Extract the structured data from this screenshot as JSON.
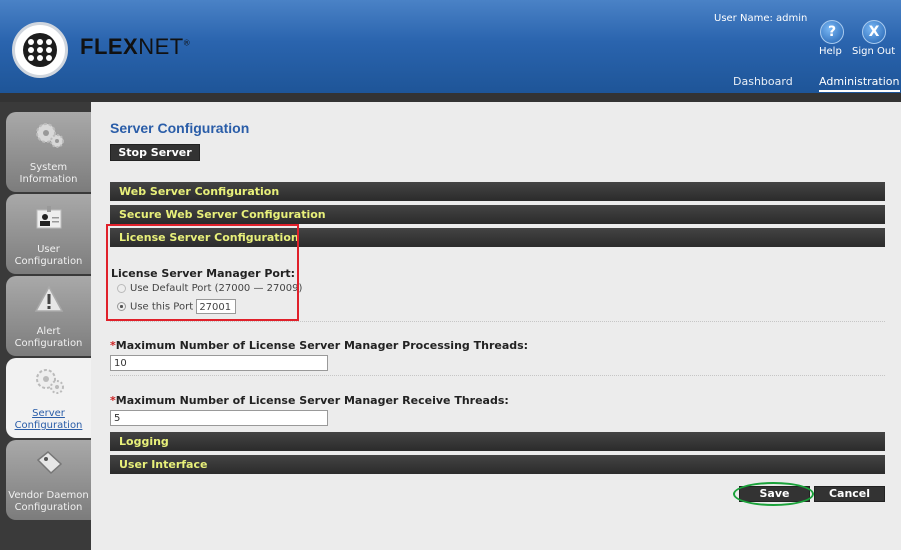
{
  "app": {
    "brand_bold": "FLEX",
    "brand_light": "NET",
    "brand_mark": "®"
  },
  "header": {
    "user_name": "User Name: admin",
    "help_label": "Help",
    "signout_label": "Sign Out",
    "help_icon": "question-icon",
    "signout_icon": "x-icon",
    "nav": [
      {
        "label": "Dashboard",
        "active": false
      },
      {
        "label": "Administration",
        "active": true
      }
    ]
  },
  "sidebar": {
    "items": [
      {
        "label": "System Information",
        "icon": "gears-icon",
        "active": false
      },
      {
        "label": "User Configuration",
        "icon": "user-card-icon",
        "active": false
      },
      {
        "label": "Alert Configuration",
        "icon": "warning-icon",
        "active": false
      },
      {
        "label": "Server Configuration",
        "icon": "gears-icon",
        "active": true
      },
      {
        "label": "Vendor Daemon Configuration",
        "icon": "tag-icon",
        "active": false
      }
    ]
  },
  "main": {
    "title": "Server Configuration",
    "stop_button": "Stop Server",
    "sections": {
      "web": "Web Server Configuration",
      "secure_web": "Secure Web Server Configuration",
      "license": "License Server Configuration",
      "logging": "Logging",
      "ui": "User Interface"
    },
    "license": {
      "port_label": "License Server Manager Port:",
      "default_port_option": "Use Default Port (27000 — 27009)",
      "custom_port_option": "Use this Port",
      "custom_port_value": "27001",
      "selected_option": "custom"
    },
    "processing_threads": {
      "required_mark": "*",
      "label": "Maximum Number of License Server Manager Processing Threads:",
      "value": "10"
    },
    "receive_threads": {
      "required_mark": "*",
      "label": "Maximum Number of License Server Manager Receive Threads:",
      "value": "5"
    },
    "save_button": "Save",
    "cancel_button": "Cancel"
  },
  "colors": {
    "header_blue": "#2a64ae",
    "title_blue": "#2a5da8",
    "bar_text": "#e8f07a",
    "highlight_red": "#e0202a",
    "highlight_green": "#1aa23a"
  }
}
